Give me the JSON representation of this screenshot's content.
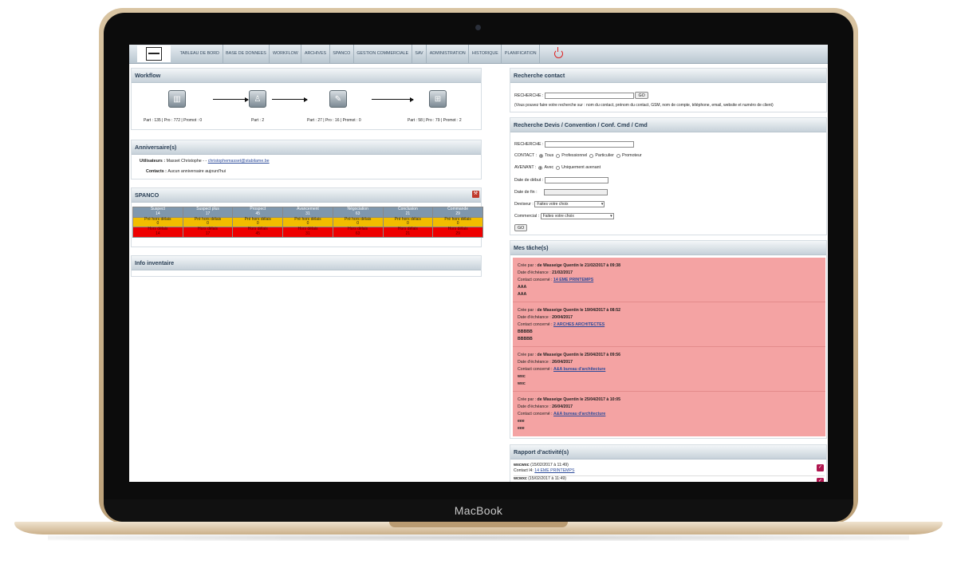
{
  "device": {
    "brand": "MacBook"
  },
  "nav": {
    "items": [
      "TABLEAU DE BORD",
      "BASE DE DONNEES",
      "WORKFLOW",
      "ARCHIVES",
      "SPANCO",
      "GESTION COMMERCIALE",
      "SAV",
      "ADMINISTRATION",
      "HISTORIQUE",
      "PLANIFICATION"
    ]
  },
  "workflow": {
    "title": "Workflow",
    "steps": [
      {
        "icon": "building-icon",
        "stats": "Part : 135 | Pro : 772 | Promot : 0"
      },
      {
        "icon": "people-icon",
        "stats": "Part : 2"
      },
      {
        "icon": "contract-icon",
        "stats": "Part : 27 | Pro : 16 | Promot : 0"
      },
      {
        "icon": "cart-icon",
        "stats": "Part : 58 | Pro : 79 | Promot : 2"
      }
    ]
  },
  "anniversaires": {
    "title": "Anniversaire(s)",
    "users_label": "Utilisateurs :",
    "users_value": "Masset Christophe - -",
    "users_email": "christophemasset@stabilame.be",
    "contacts_label": "Contacts :",
    "contacts_value": "Aucun anniversaire aujourd'hui"
  },
  "spanco": {
    "title": "SPANCO",
    "columns": [
      {
        "name": "Suspect",
        "count": "14"
      },
      {
        "name": "Suspect plus",
        "count": "17"
      },
      {
        "name": "Prospect",
        "count": "45"
      },
      {
        "name": "Avancement",
        "count": "31"
      },
      {
        "name": "Négociation",
        "count": "63"
      },
      {
        "name": "Conclusion",
        "count": "21"
      },
      {
        "name": "Commande",
        "count": "29"
      }
    ],
    "pre_label": "Pré hors délais",
    "pre_values": [
      "0",
      "0",
      "0",
      "0",
      "0",
      "0",
      "0"
    ],
    "hors_label": "Hors délais",
    "hors_values": [
      "14",
      "17",
      "45",
      "31",
      "63",
      "21",
      "29"
    ]
  },
  "inventaire": {
    "title": "Info inventaire"
  },
  "recherche": {
    "title": "Recherche contact",
    "label": "RECHERCHE :",
    "button": "GO",
    "hint": "(Vous pouvez faire votre recherche sur : nom du contact, prénom du contact, GSM, nom de compte, téléphone, email, website et numéro de client)"
  },
  "devis": {
    "title": "Recherche Devis / Convention / Conf. Cmd / Cmd",
    "recherche_label": "RECHERCHE :",
    "contact_label": "CONTACT :",
    "contact_options": [
      "Tous",
      "Professionnel",
      "Particulier",
      "Promoteur"
    ],
    "avenant_label": "AVENANT :",
    "avenant_options": [
      "Avec",
      "Uniquement avenant"
    ],
    "date_debut_label": "Date de début :",
    "date_fin_label": "Date de fin :",
    "deviseur_label": "Deviseur :",
    "deviseur_value": "Faites votre choix",
    "commercial_label": "Commercial :",
    "commercial_value": "Faites votre choix",
    "button": "GO"
  },
  "taches": {
    "title": "Mes tâche(s)",
    "created_label": "Crée par :",
    "due_label": "Date d'échéance :",
    "contact_label": "Contact concerné :",
    "items": [
      {
        "creator": "de Wasseige Quentin le 21/02/2017 à 09:38",
        "due": "21/02/2017",
        "contact": "14 EME PRINTEMPS",
        "line1": "AAA",
        "line2": "AAA"
      },
      {
        "creator": "de Wasseige Quentin le 19/04/2017 à 08:52",
        "due": "20/04/2017",
        "contact": "2 ARCHES ARCHITECTES",
        "line1": "BBBBB",
        "line2": "BBBBB"
      },
      {
        "creator": "de Wasseige Quentin le 25/04/2017 à 09:56",
        "due": "26/04/2017",
        "contact": "A&A bureau d'architecture",
        "line1": "wxc",
        "line2": "wxc"
      },
      {
        "creator": "de Wasseige Quentin le 25/04/2017 à 10:05",
        "due": "26/04/2017",
        "contact": "A&A bureau d'architecture",
        "line1": "eee",
        "line2": "eee"
      }
    ]
  },
  "rapport": {
    "title": "Rapport d'activité(s)",
    "items": [
      {
        "name": "wxcwxc",
        "date": "(15/02/2017 à 11:49)",
        "contact_label": "Contact l4:",
        "contact": "14 EME PRINTEMPS"
      },
      {
        "name": "wcwxc",
        "date": "(15/02/2017 à 11:49)",
        "contact_label": "",
        "contact": ""
      }
    ]
  },
  "colors": {
    "nav": "#c4d0d9",
    "spanco_head": "#7f97ad",
    "spanco_yellow": "#f2bd00",
    "spanco_red": "#ee0000",
    "task_bg": "#f4a3a3",
    "check": "#b0164f"
  }
}
